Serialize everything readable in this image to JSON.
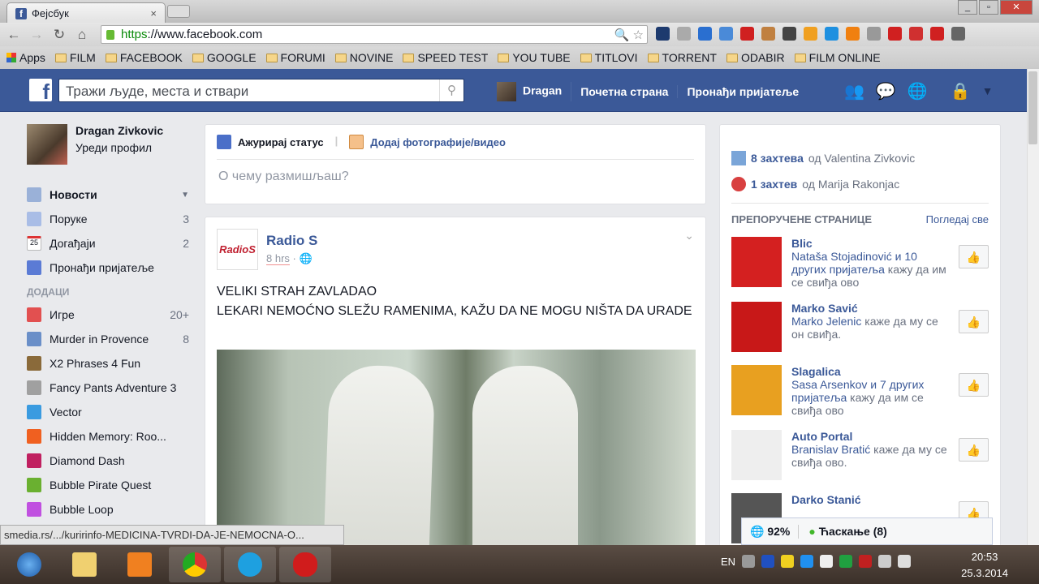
{
  "browser": {
    "tab_title": "Фејсбук",
    "url_scheme": "https",
    "url_rest": "://www.facebook.com",
    "bookmarks": [
      "Apps",
      "FILM",
      "FACEBOOK",
      "GOOGLE",
      "FORUMI",
      "NOVINE",
      "SPEED TEST",
      "YOU TUBE",
      "TITLOVI",
      "TORRENT",
      "ODABIR",
      "FILM ONLINE"
    ],
    "status_url": "smedia.rs/.../kuririnfo-MEDICINA-TVRDI-DA-JE-NEMOCNA-O..."
  },
  "header": {
    "search_placeholder": "Тражи људе, места и ствари",
    "user": "Dragan",
    "home": "Почетна страна",
    "find_friends": "Пронађи пријатеље"
  },
  "left": {
    "name": "Dragan Zivkovic",
    "edit": "Уреди профил",
    "nav": [
      {
        "label": "Новости",
        "count": ""
      },
      {
        "label": "Поруке",
        "count": "3"
      },
      {
        "label": "Догађаји",
        "count": "2"
      },
      {
        "label": "Пронађи пријатеље",
        "count": ""
      }
    ],
    "apps_title": "ДОДАЦИ",
    "apps": [
      {
        "label": "Игре",
        "count": "20+",
        "color": "#e25050"
      },
      {
        "label": "Murder in Provence",
        "count": "8",
        "color": "#6a8fc8"
      },
      {
        "label": "X2 Phrases 4 Fun",
        "count": "",
        "color": "#8a6a3a"
      },
      {
        "label": "Fancy Pants Adventure 3",
        "count": "",
        "color": "#a0a0a0"
      },
      {
        "label": "Vector",
        "count": "",
        "color": "#3a9be0"
      },
      {
        "label": "Hidden Memory: Roo...",
        "count": "",
        "color": "#f06020"
      },
      {
        "label": "Diamond Dash",
        "count": "",
        "color": "#c02060"
      },
      {
        "label": "Bubble Pirate Quest",
        "count": "",
        "color": "#6ab030"
      },
      {
        "label": "Bubble Loop",
        "count": "",
        "color": "#c050e0"
      }
    ]
  },
  "composer": {
    "status": "Ажурирај статус",
    "photo": "Додај фотографије/видео",
    "placeholder": "О чему размишљаш?"
  },
  "post": {
    "page": "Radio S",
    "time": "8 hrs",
    "line1": "VELIKI STRAH ZAVLADAO",
    "line2": "LEKARI NEMOĆNO SLEŽU RAMENIMA, KAŽU DA NE MOGU NIŠTA DA URADE"
  },
  "right": {
    "requests": [
      {
        "count": "8 захтева",
        "from": "од Valentina Zivkovic"
      },
      {
        "count": "1 захтев",
        "from": "од Marija Rakonjac"
      }
    ],
    "rec_title": "ПРЕПОРУЧЕНЕ СТРАНИЦЕ",
    "see_all": "Погледај све",
    "pages": [
      {
        "name": "Blic",
        "friends": "Nataša Stojadinović и 10 других пријатеља",
        "rest": " кажу да им се свиђа ово",
        "color": "#d42020"
      },
      {
        "name": "Marko Savić",
        "friends": "Marko Jelenic",
        "rest": " каже да му се он свиђа.",
        "color": "#c81818"
      },
      {
        "name": "Slagalica",
        "friends": "Sasa Arsenkov и 7 других пријатеља",
        "rest": " кажу да им се свиђа ово",
        "color": "#e8a020"
      },
      {
        "name": "Auto Portal",
        "friends": "Branislav Bratić",
        "rest": " каже да му се свиђа ово.",
        "color": "#eeeeee"
      },
      {
        "name": "Darko Stanić",
        "friends": "",
        "rest": "",
        "color": "#555555"
      }
    ]
  },
  "chat": {
    "zoom": "92%",
    "label": "Ћаскање (8)"
  },
  "taskbar": {
    "lang": "EN",
    "time": "20:53",
    "date": "25.3.2014"
  }
}
